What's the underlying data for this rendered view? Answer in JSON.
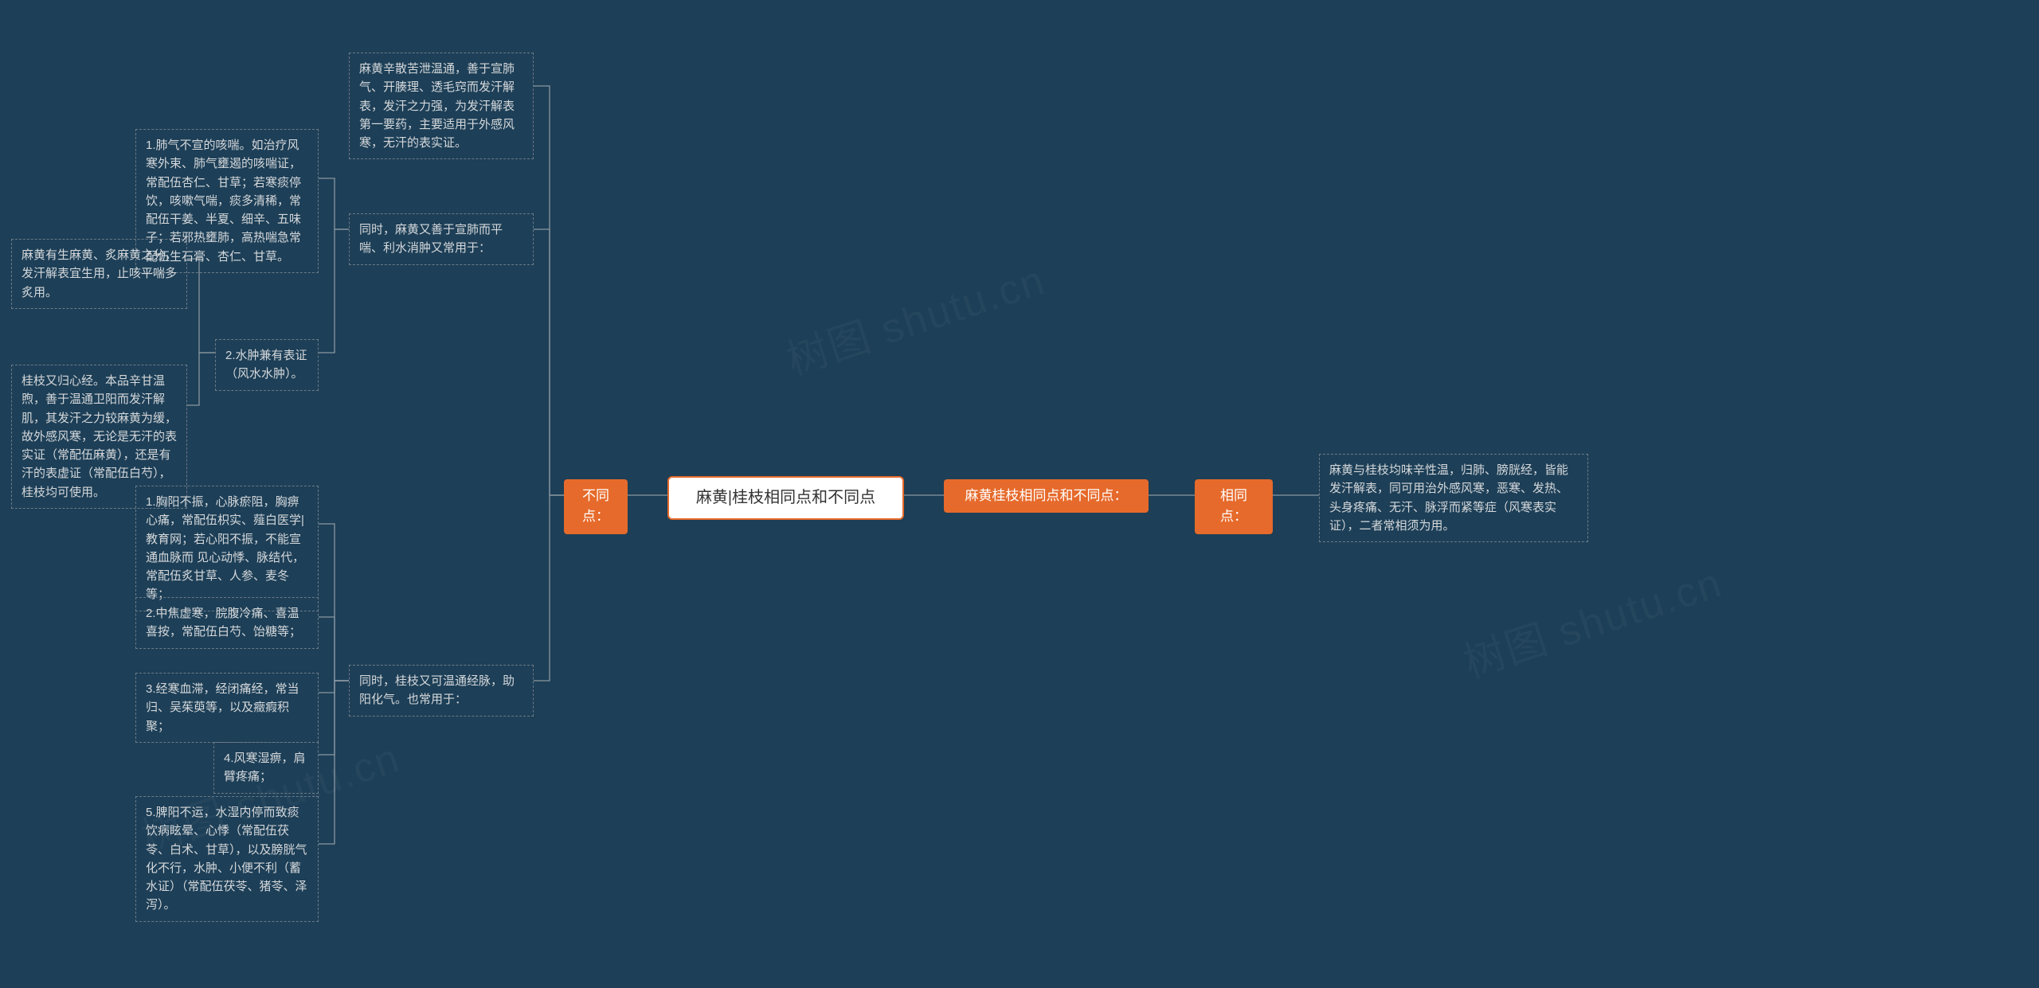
{
  "root": "麻黄|桂枝相同点和不同点",
  "right_branch_label": "麻黄桂枝相同点和不同点：",
  "same_label": "相同点：",
  "same_detail": "麻黄与桂枝均味辛性温，归肺、膀胱经，皆能发汗解表，同可用治外感风寒，恶寒、发热、头身疼痛、无汗、脉浮而紧等症（风寒表实证），二者常相须为用。",
  "diff_label": "不同点：",
  "diff_mahuang_main": "麻黄辛散苦泄温通，善于宣肺气、开腠理、透毛窍而发汗解表，发汗之力强，为发汗解表第一要药，主要适用于外感风寒，无汗的表实证。",
  "diff_mahuang_also": "同时，麻黄又善于宣肺而平喘、利水消肿又常用于：",
  "diff_mahuang_sub1": "1.肺气不宣的咳喘。如治疗风寒外束、肺气壅遏的咳喘证，常配伍杏仁、甘草；若寒痰停饮，咳嗽气喘，痰多清稀，常配伍干姜、半夏、细辛、五味子；若邪热壅肺，高热喘急常配伍生石膏、杏仁、甘草。",
  "diff_mahuang_sub2": "2.水肿兼有表证（风水水肿）。",
  "diff_mahuang_note": "麻黄有生麻黄、炙麻黄之分，发汗解表宜生用，止咳平喘多炙用。",
  "diff_guizhi_main": "桂枝又归心经。本品辛甘温煦，善于温通卫阳而发汗解肌，其发汗之力较麻黄为缓，故外感风寒，无论是无汗的表实证（常配伍麻黄），还是有汗的表虚证（常配伍白芍），桂枝均可使用。",
  "diff_guizhi_also": "同时，桂枝又可温通经脉，助阳化气。也常用于：",
  "diff_guizhi_sub1": "1.胸阳不振，心脉瘀阻，胸痹心痛，常配伍枳实、薤白医学|教育网；若心阳不振，不能宣通血脉而 见心动悸、脉结代，常配伍炙甘草、人参、麦冬等；",
  "diff_guizhi_sub2": "2.中焦虚寒，脘腹冷痛、喜温喜按，常配伍白芍、饴糖等；",
  "diff_guizhi_sub3": "3.经寒血滞，经闭痛经，常当归、吴茱萸等，以及癥瘕积聚；",
  "diff_guizhi_sub4": "4.风寒湿痹，肩臂疼痛；",
  "diff_guizhi_sub5": "5.脾阳不运，水湿内停而致痰饮病眩晕、心悸（常配伍茯苓、白术、甘草），以及膀胱气化不行，水肿、小便不利（蓄水证）（常配伍茯苓、猪苓、泽泻）。",
  "watermark": "树图 shutu.cn"
}
